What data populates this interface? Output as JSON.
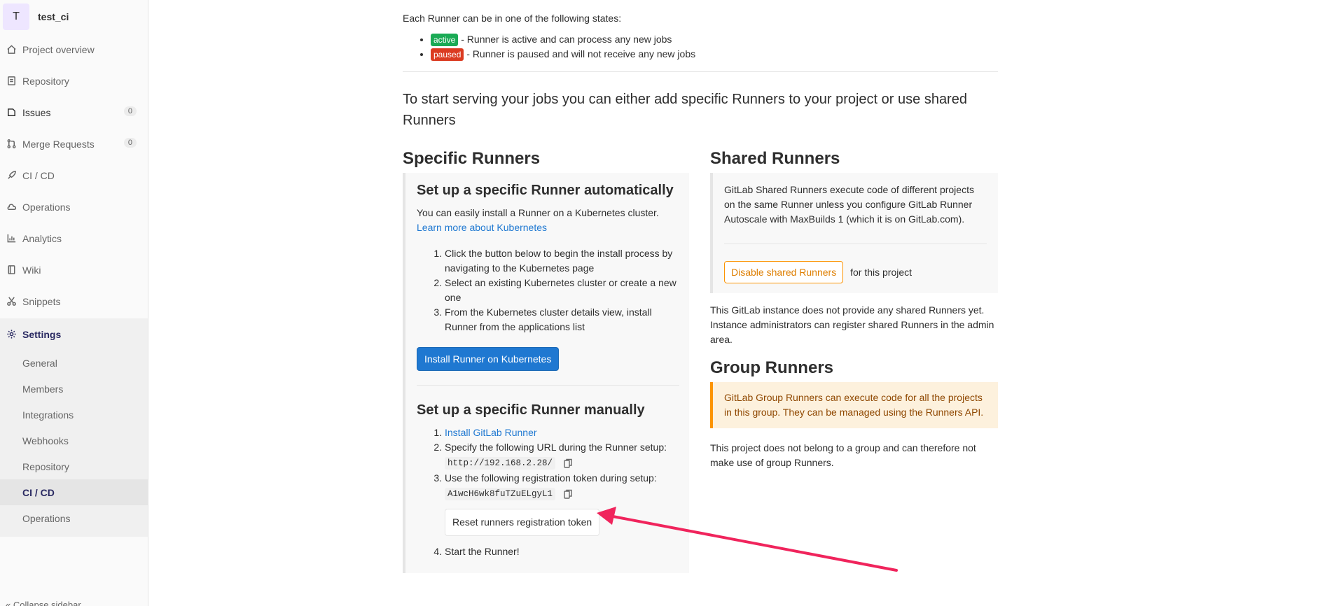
{
  "project": {
    "initial": "T",
    "name": "test_ci"
  },
  "sidebar": {
    "items": [
      {
        "label": "Project overview",
        "icon": "home-icon"
      },
      {
        "label": "Repository",
        "icon": "doc-icon"
      },
      {
        "label": "Issues",
        "icon": "issues-icon",
        "count": "0"
      },
      {
        "label": "Merge Requests",
        "icon": "merge-icon",
        "count": "0"
      },
      {
        "label": "CI / CD",
        "icon": "rocket-icon"
      },
      {
        "label": "Operations",
        "icon": "cloud-icon"
      },
      {
        "label": "Analytics",
        "icon": "chart-icon"
      },
      {
        "label": "Wiki",
        "icon": "book-icon"
      },
      {
        "label": "Snippets",
        "icon": "scissors-icon"
      }
    ],
    "settings": {
      "label": "Settings",
      "sub": [
        "General",
        "Members",
        "Integrations",
        "Webhooks",
        "Repository",
        "CI / CD",
        "Operations"
      ]
    },
    "collapse": "Collapse sidebar"
  },
  "states": {
    "intro": "Each Runner can be in one of the following states:",
    "active_pill": "active",
    "active_text": " - Runner is active and can process any new jobs",
    "paused_pill": "paused",
    "paused_text": " - Runner is paused and will not receive any new jobs"
  },
  "lead": "To start serving your jobs you can either add specific Runners to your project or use shared Runners",
  "specific": {
    "heading": "Specific Runners",
    "auto_heading": "Set up a specific Runner automatically",
    "auto_text": "You can easily install a Runner on a Kubernetes cluster.",
    "auto_link": "Learn more about Kubernetes",
    "steps": [
      "Click the button below to begin the install process by navigating to the Kubernetes page",
      "Select an existing Kubernetes cluster or create a new one",
      "From the Kubernetes cluster details view, install Runner from the applications list"
    ],
    "install_button": "Install Runner on Kubernetes",
    "manual_heading": "Set up a specific Runner manually",
    "manual_step1_link": "Install GitLab Runner",
    "manual_step2": "Specify the following URL during the Runner setup:",
    "url": "http://192.168.2.28/",
    "manual_step3": "Use the following registration token during setup:",
    "token": "A1wcH6wk8fuTZuELgyL1",
    "reset_button": "Reset runners registration token",
    "manual_step4": "Start the Runner!"
  },
  "shared": {
    "heading": "Shared Runners",
    "text": "GitLab Shared Runners execute code of different projects on the same Runner unless you configure GitLab Runner Autoscale with MaxBuilds 1 (which it is on GitLab.com).",
    "disable_button": "Disable shared Runners",
    "for_project": "for this project",
    "after": "This GitLab instance does not provide any shared Runners yet. Instance administrators can register shared Runners in the admin area."
  },
  "group": {
    "heading": "Group Runners",
    "text": "GitLab Group Runners can execute code for all the projects in this group. They can be managed using the Runners API.",
    "after": "This project does not belong to a group and can therefore not make use of group Runners."
  },
  "colors": {
    "accent": "#1f78d1",
    "arrow": "#f0245c",
    "active": "#1aaa55",
    "paused": "#db3b21",
    "warning": "#fc9403"
  }
}
